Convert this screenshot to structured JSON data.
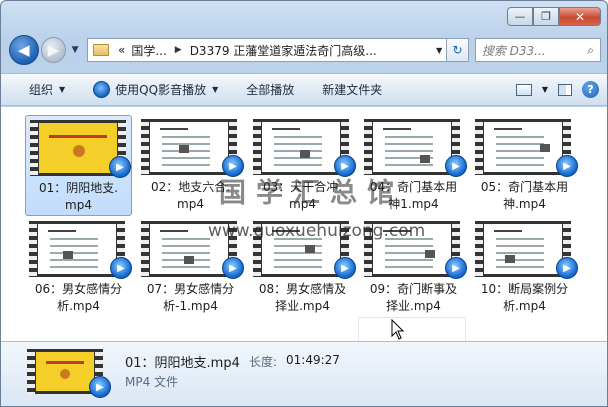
{
  "window": {
    "caption": {
      "minimize": "—",
      "maximize": "❐",
      "close": "✕"
    }
  },
  "nav": {
    "back": "◀",
    "forward": "▶",
    "history_drop": "▼",
    "breadcrumbs": [
      "«",
      "国学...",
      "D3379 正藩堂道家遁法奇门高级..."
    ],
    "address_drop": "▼",
    "refresh": "↻",
    "search_placeholder": "搜索 D33..."
  },
  "toolbar": {
    "organize": "组织",
    "play_qq": "使用QQ影音播放",
    "play_all": "全部播放",
    "new_folder": "新建文件夹"
  },
  "files": [
    {
      "name": "01：阴阳地支.mp4",
      "line1": "01：阴阳地支.",
      "line2": "mp4",
      "selected": true,
      "style": "yellow"
    },
    {
      "name": "02：地支六合.mp4",
      "line1": "02：地支六合.",
      "line2": "mp4",
      "selected": false,
      "style": "white"
    },
    {
      "name": "03：天干合冲.mp4",
      "line1": "03：天干合冲.",
      "line2": "mp4",
      "selected": false,
      "style": "white"
    },
    {
      "name": "04：奇门基本用神1.mp4",
      "line1": "04：奇门基本用",
      "line2": "神1.mp4",
      "selected": false,
      "style": "white"
    },
    {
      "name": "05：奇门基本用神.mp4",
      "line1": "05：奇门基本用",
      "line2": "神.mp4",
      "selected": false,
      "style": "white"
    },
    {
      "name": "06：男女感情分析.mp4",
      "line1": "06：男女感情分",
      "line2": "析.mp4",
      "selected": false,
      "style": "white"
    },
    {
      "name": "07：男女感情分析-1.mp4",
      "line1": "07：男女感情分",
      "line2": "析-1.mp4",
      "selected": false,
      "style": "white"
    },
    {
      "name": "08：男女感情及择业.mp4",
      "line1": "08：男女感情及",
      "line2": "择业.mp4",
      "selected": false,
      "style": "white"
    },
    {
      "name": "09：奇门断事及择业.mp4",
      "line1": "09：奇门断事及",
      "line2": "择业.mp4",
      "selected": false,
      "style": "white"
    },
    {
      "name": "10：断局案例分析.mp4",
      "line1": "10：断局案例分",
      "line2": "析.mp4",
      "selected": false,
      "style": "white"
    }
  ],
  "watermark": {
    "text": "国学汇总馆",
    "url": "www.guoxuehuizong.com"
  },
  "details": {
    "name": "01：阴阳地支.mp4",
    "length_label": "长度:",
    "length_value": "01:49:27",
    "type": "MP4 文件"
  },
  "colors": {
    "window_frame": "#b9d1ea",
    "selection": "#c1dcfc",
    "close_button": "#c74a32",
    "qq_badge": "#1569d2"
  }
}
